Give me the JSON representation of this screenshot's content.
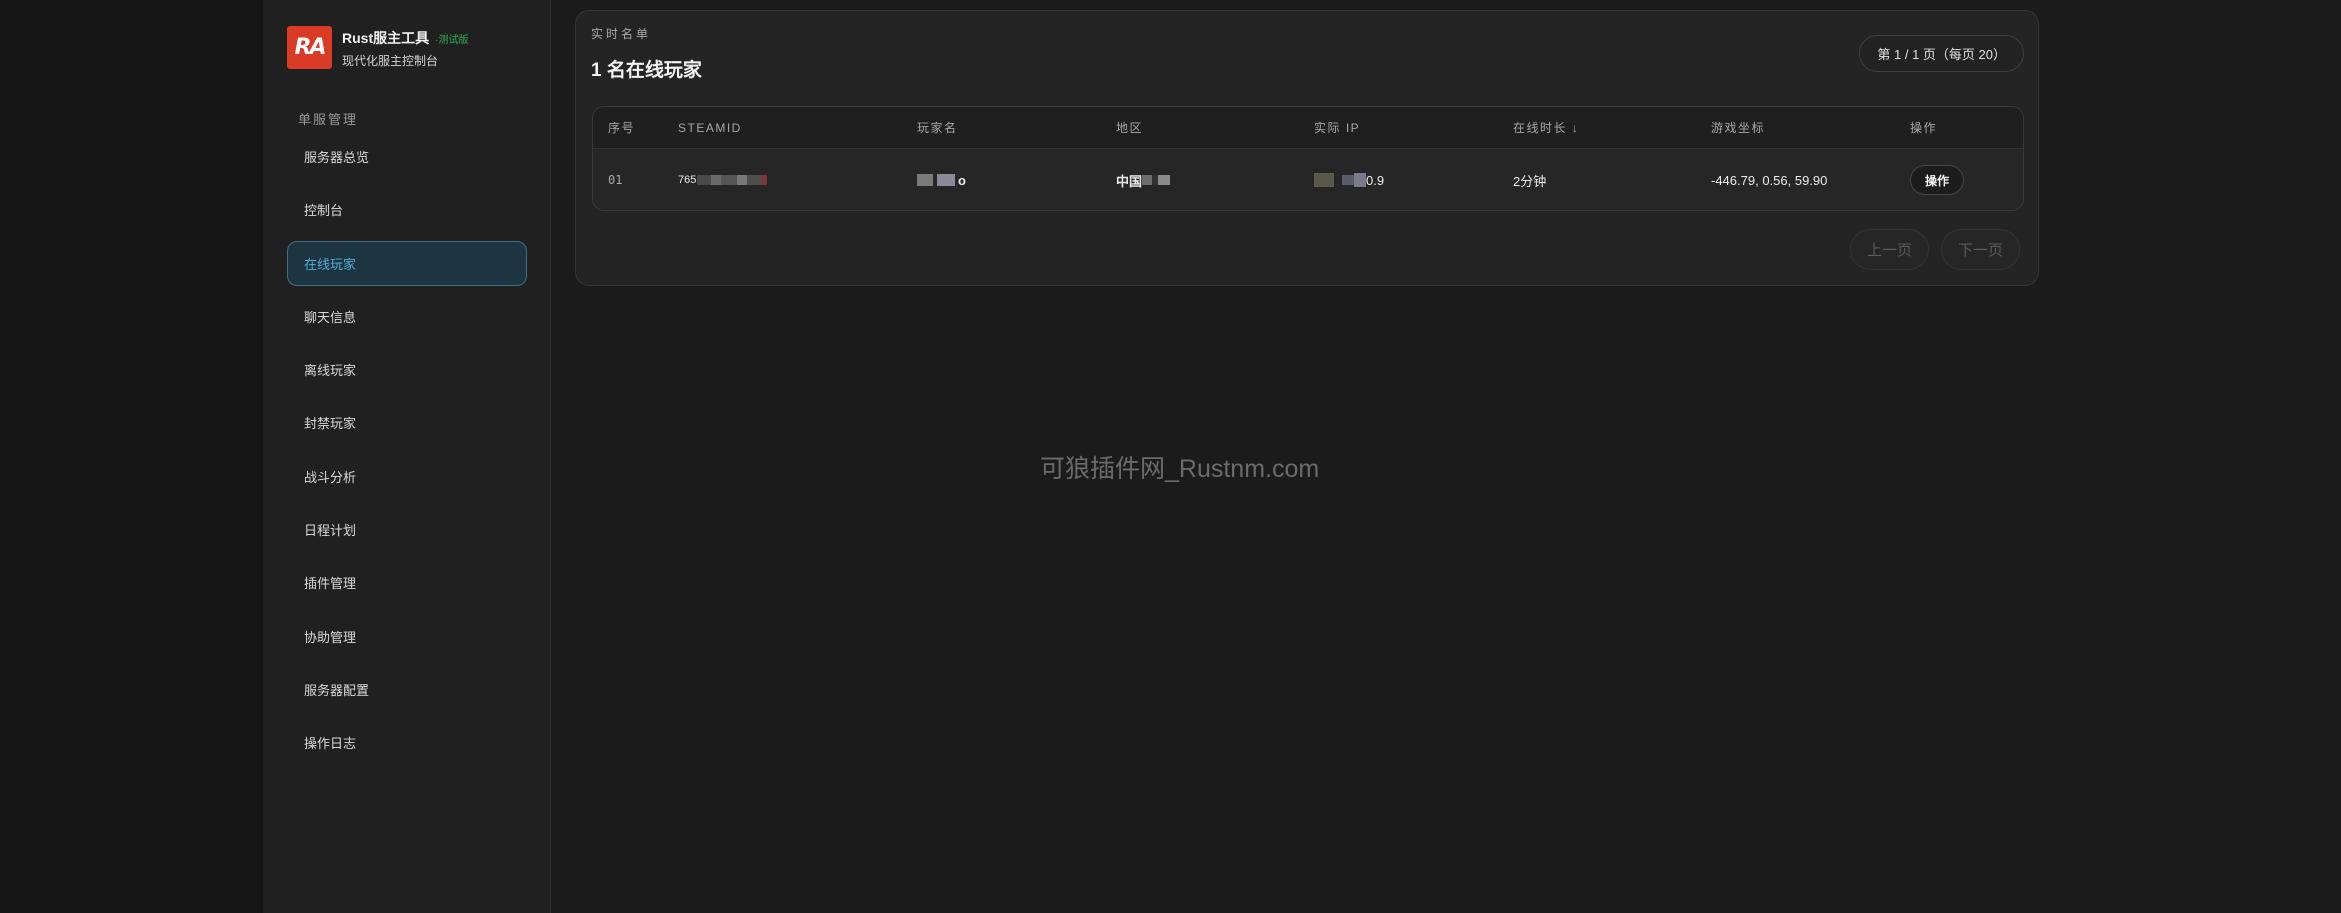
{
  "brand": {
    "title": "Rust服主工具",
    "badge": "·测试版",
    "subtitle": "现代化服主控制台",
    "logo_text": "RA"
  },
  "sidebar": {
    "section_title": "单服管理",
    "items": [
      {
        "label": "服务器总览",
        "active": false
      },
      {
        "label": "控制台",
        "active": false
      },
      {
        "label": "在线玩家",
        "active": true
      },
      {
        "label": "聊天信息",
        "active": false
      },
      {
        "label": "离线玩家",
        "active": false
      },
      {
        "label": "封禁玩家",
        "active": false
      },
      {
        "label": "战斗分析",
        "active": false
      },
      {
        "label": "日程计划",
        "active": false
      },
      {
        "label": "插件管理",
        "active": false
      },
      {
        "label": "协助管理",
        "active": false
      },
      {
        "label": "服务器配置",
        "active": false
      },
      {
        "label": "操作日志",
        "active": false
      }
    ]
  },
  "main": {
    "eyebrow": "实时名单",
    "title": "1 名在线玩家",
    "page_info": "第 1 / 1 页（每页 20）",
    "table": {
      "headers": [
        "序号",
        "STEAMID",
        "玩家名",
        "地区",
        "实际 IP",
        "在线时长 ↓",
        "游戏坐标",
        "操作"
      ],
      "rows": [
        {
          "index": "01",
          "steamid": "765",
          "player_name": "o",
          "region": "中国",
          "ip": "0.9",
          "online_time": "2分钟",
          "coords": "-446.79, 0.56, 59.90",
          "action": "操作"
        }
      ]
    },
    "prev_label": "上一页",
    "next_label": "下一页"
  },
  "watermark": "可狼插件网_Rustnm.com",
  "colors": {
    "accent": "#4fb0d8",
    "logo": "#d93b26",
    "badge": "#2fae54"
  }
}
